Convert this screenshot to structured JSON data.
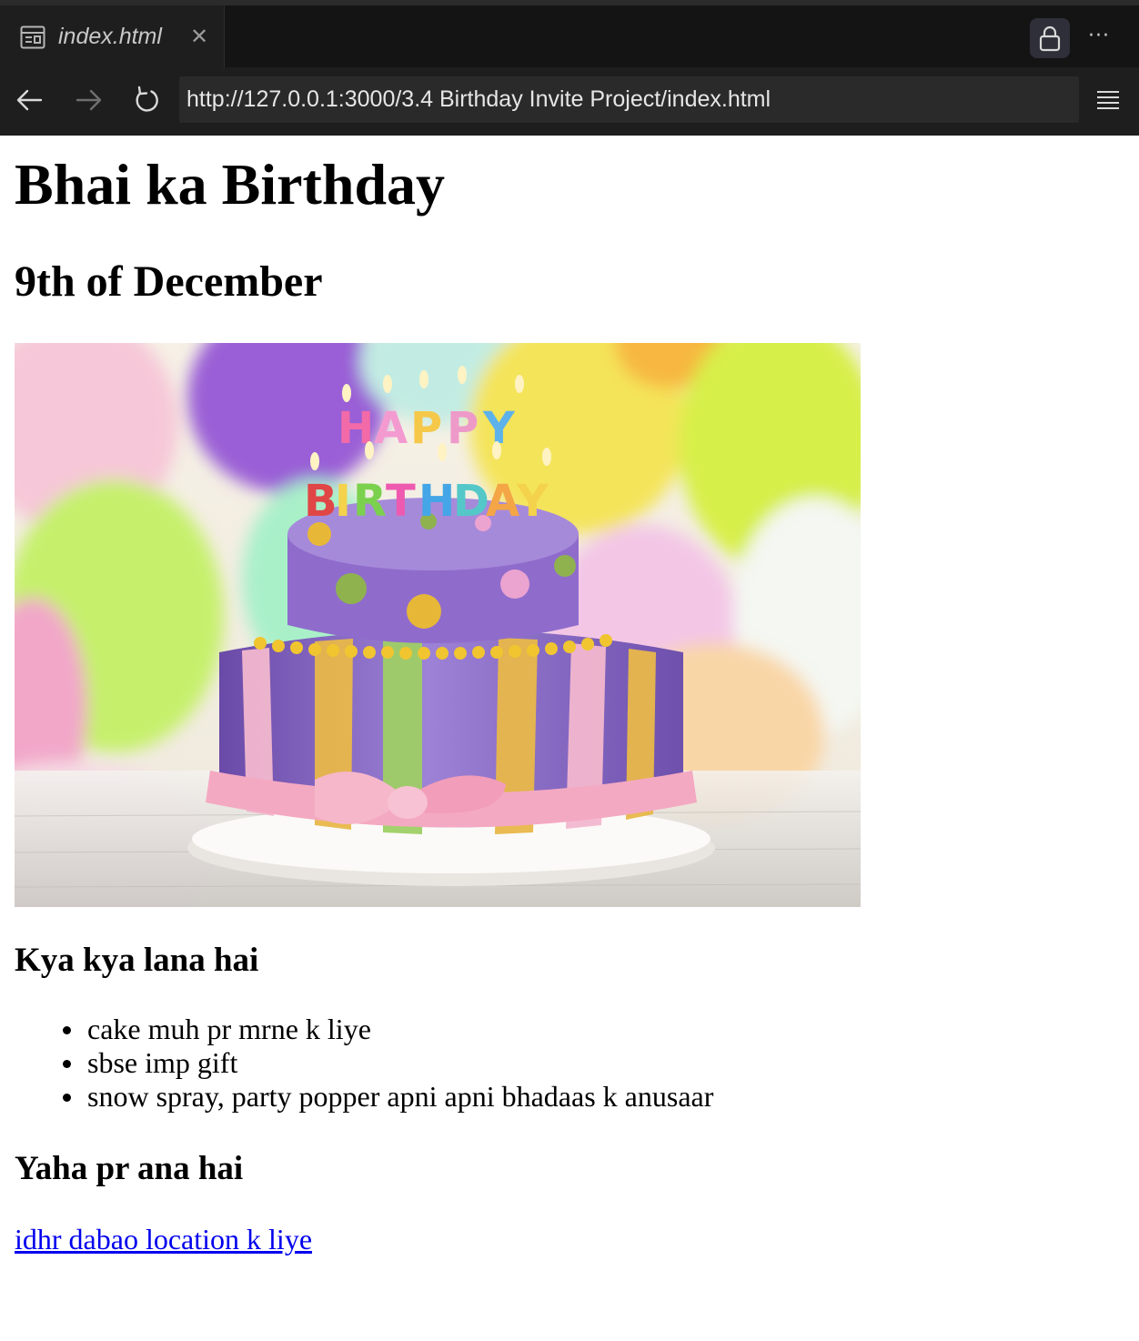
{
  "browser": {
    "tab": {
      "title": "index.html",
      "icon": "browser-preview-icon",
      "close_icon": "close-icon"
    },
    "url": "http://127.0.0.1:3000/3.4 Birthday Invite Project/index.html",
    "controls": {
      "back_icon": "arrow-left-icon",
      "forward_icon": "arrow-right-icon",
      "reload_icon": "reload-icon",
      "lock_icon": "lock-icon",
      "more_icon": "more-horizontal-icon",
      "menu_icon": "menu-lines-icon"
    }
  },
  "page": {
    "title": "Bhai ka Birthday",
    "date": "9th of December",
    "image": {
      "description": "birthday-cake-image"
    },
    "bring_heading": "Kya kya lana hai",
    "bring_items": [
      "cake muh pr mrne k liye",
      "sbse imp gift",
      "snow spray, party popper apni apni bhadaas k anusaar"
    ],
    "location_heading": "Yaha pr ana hai",
    "location_link": "idhr dabao location k liye"
  },
  "colors": {
    "chrome_bg": "#1e1e1e",
    "tabbar_bg": "#141414",
    "urlbar_bg": "#2a2a2a",
    "link": "#0000ee"
  }
}
